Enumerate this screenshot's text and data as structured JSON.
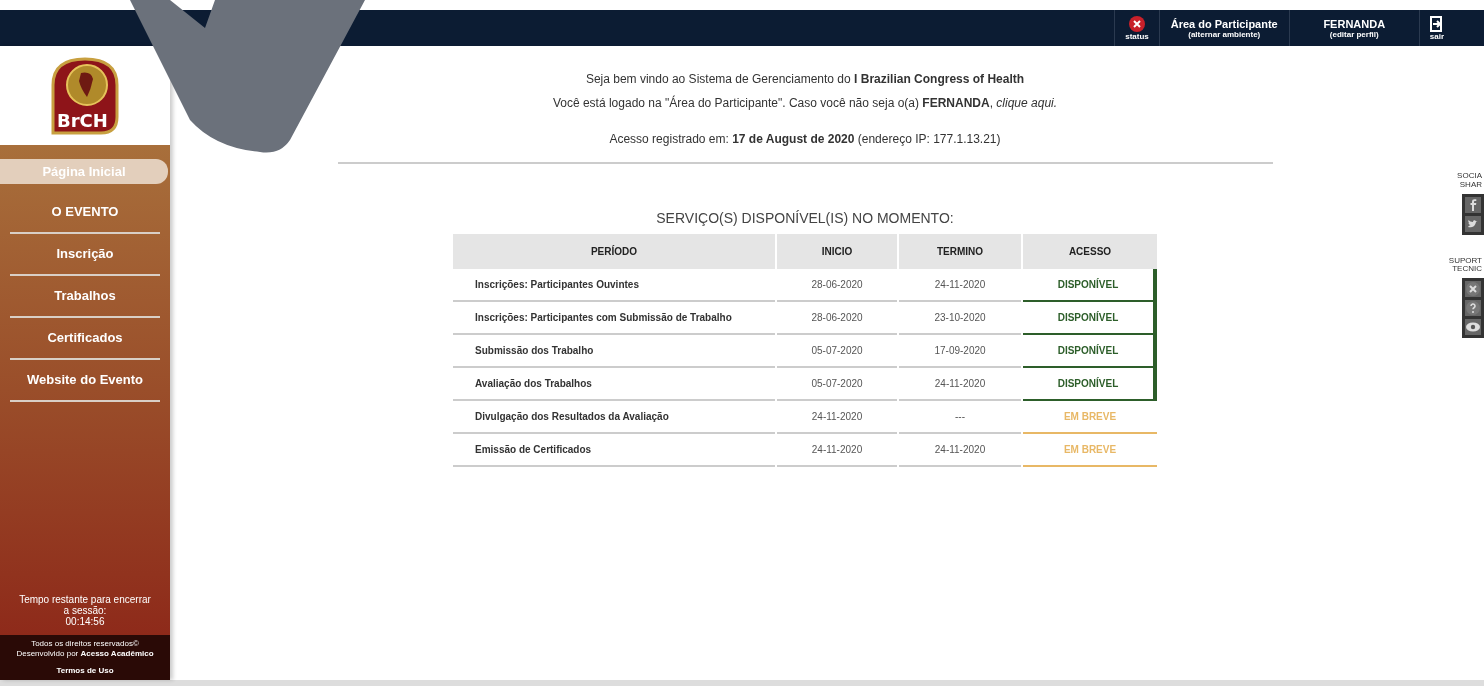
{
  "top_bar": {
    "status_label": "status",
    "area": {
      "title": "Área do Participante",
      "subtitle": "(alternar ambiente)"
    },
    "user": {
      "name": "FERNANDA",
      "subtitle": "(editar perfil)"
    },
    "logout_label": "sair"
  },
  "logo": {
    "text": "BrCH"
  },
  "sidebar": {
    "items": [
      {
        "label": "Página Inicial",
        "selected": true
      },
      {
        "label": "O EVENTO",
        "selected": false
      },
      {
        "label": "Inscrição",
        "selected": false
      },
      {
        "label": "Trabalhos",
        "selected": false
      },
      {
        "label": "Certificados",
        "selected": false
      },
      {
        "label": "Website do Evento",
        "selected": false
      }
    ],
    "session": {
      "text": "Tempo restante para encerrar a sessão:",
      "time": "00:14:56"
    },
    "footer": {
      "rights": "Todos os direitos reservados©",
      "developer": "Desenvolvido por **Acesso Acadêmico**",
      "terms": "Termos de Uso"
    }
  },
  "main": {
    "welcome": "Seja bem vindo ao Sistema de Gerenciamento do **I Brazilian Congress of Health**",
    "logged": "Você está logado na \"Área do Participante\". Caso você não seja o(a) **FERNANDA**,",
    "logged_link": "clique aqui.",
    "access": "Acesso registrado em: **17 de August de 2020** (endereço IP: 177.1.13.21)",
    "services_title": "SERVIÇO(S) DISPONÍVEL(IS) NO MOMENTO:",
    "table": {
      "columns": [
        "PERÍODO",
        "INICIO",
        "TERMINO",
        "ACESSO"
      ],
      "rows": [
        {
          "period": "Inscrições: Participantes Ouvintes",
          "start": "28-06-2020",
          "end": "24-11-2020",
          "access": {
            "label": "DISPONÍVEL",
            "kind": "available"
          }
        },
        {
          "period": "Inscrições: Participantes com Submissão de Trabalho",
          "start": "28-06-2020",
          "end": "23-10-2020",
          "access": {
            "label": "DISPONÍVEL",
            "kind": "available"
          }
        },
        {
          "period": "Submissão dos Trabalho",
          "start": "05-07-2020",
          "end": "17-09-2020",
          "access": {
            "label": "DISPONÍVEL",
            "kind": "available"
          }
        },
        {
          "period": "Avaliação dos Trabalhos",
          "start": "05-07-2020",
          "end": "24-11-2020",
          "access": {
            "label": "DISPONÍVEL",
            "kind": "available"
          }
        },
        {
          "period": "Divulgação dos Resultados da Avaliação",
          "start": "24-11-2020",
          "end": "---",
          "access": {
            "label": "EM BREVE",
            "kind": "soon"
          }
        },
        {
          "period": "Emissão de Certificados",
          "start": "24-11-2020",
          "end": "24-11-2020",
          "access": {
            "label": "EM BREVE",
            "kind": "soon"
          }
        }
      ]
    }
  },
  "side_panel": {
    "social_label": "SOCIA SHAR",
    "support_label": "SUPORT TECNIC"
  }
}
